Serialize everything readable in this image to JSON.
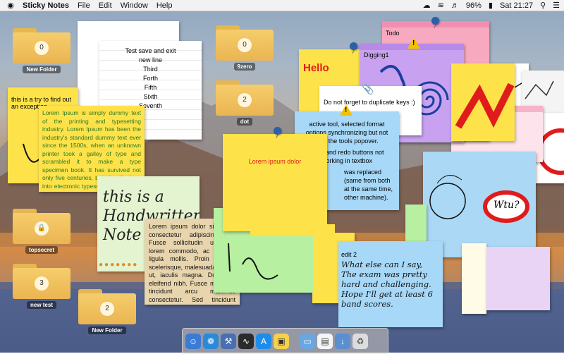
{
  "menubar": {
    "apple": "",
    "app_name": "Sticky Notes",
    "items": [
      "File",
      "Edit",
      "Window",
      "Help"
    ],
    "battery": "96%",
    "clock": "Sat 21:27"
  },
  "folders": [
    {
      "count": "0",
      "name": "New Folder"
    },
    {
      "count": "0",
      "name": "9zero"
    },
    {
      "count": "2",
      "name": "dot"
    },
    {
      "count": "",
      "name": "topsecret"
    },
    {
      "count": "3",
      "name": "new test"
    },
    {
      "count": "2",
      "name": "New Folder"
    }
  ],
  "notes": {
    "test_save": {
      "lines": [
        "Test save and exit",
        "new line",
        "Third",
        "Forth",
        "Fifth",
        "Sixth",
        "Seventh"
      ]
    },
    "todo": {
      "title": "Todo"
    },
    "hello": {
      "text": "Hello"
    },
    "digging": {
      "title": "Digging1"
    },
    "duplicate": {
      "text": "Do not forget to duplicate keys :)"
    },
    "exception": {
      "text": "this is a try to find out an exception"
    },
    "lorem_yellow": {
      "text": "Lorem Ipsum is simply dummy text of the printing and typesetting industry. Lorem Ipsum has been the industry's standard dummy text ever since the 1500s, when an unknown printer took a galley of type and scrambled it to make a type specimen book. It has survived not only five centuries, but also the leap into electronic typesetting, remaining essentially unchanged."
    },
    "handwritten": {
      "text": "this is a Handwritten Note"
    },
    "lorem_tan": {
      "text": "Lorem ipsum dolor sit amet, consectetur adipiscing elit. Fusce sollicitudin urna et lorem commodo, ac ultricies ligula mollis. Proin in leo scelerisque, malesuada metus ut, iaculis magna. Donec in eleifend nibh. Fusce maximus tincidunt arcu maximus consectetur. Sed tincidunt eros. Phasellus condimentum lorem. Nulla"
    },
    "active_tool": {
      "text": "active tool, selected format options synchronizing but not with the tools popover.",
      "text2": "undo and redo buttons not working in textbox",
      "text3": "was replaced (same from both at the same time, other machine)."
    },
    "lorem_red": {
      "text": "Lorem ipsum dolor"
    },
    "edit2": {
      "title": "edit 2",
      "text": "What else can I say, The exam was pretty hard and challenging. Hope I'll get at least 6 band scores."
    },
    "wtu": {
      "text": "Wtu?"
    }
  },
  "colors": {
    "yellow": "#fde24a",
    "pink": "#f7a9c0",
    "purple": "#c8a2f0",
    "blue": "#a7d8f8",
    "green": "#b7f0a0",
    "tan": "#e8d5ad"
  },
  "dock": {
    "apps": [
      "finder-icon",
      "safari-icon",
      "xcode-icon",
      "activity-monitor-icon",
      "appstore-icon",
      "sticky-notes-icon",
      "folder-icon",
      "document-icon",
      "downloads-icon",
      "trash-icon"
    ]
  }
}
